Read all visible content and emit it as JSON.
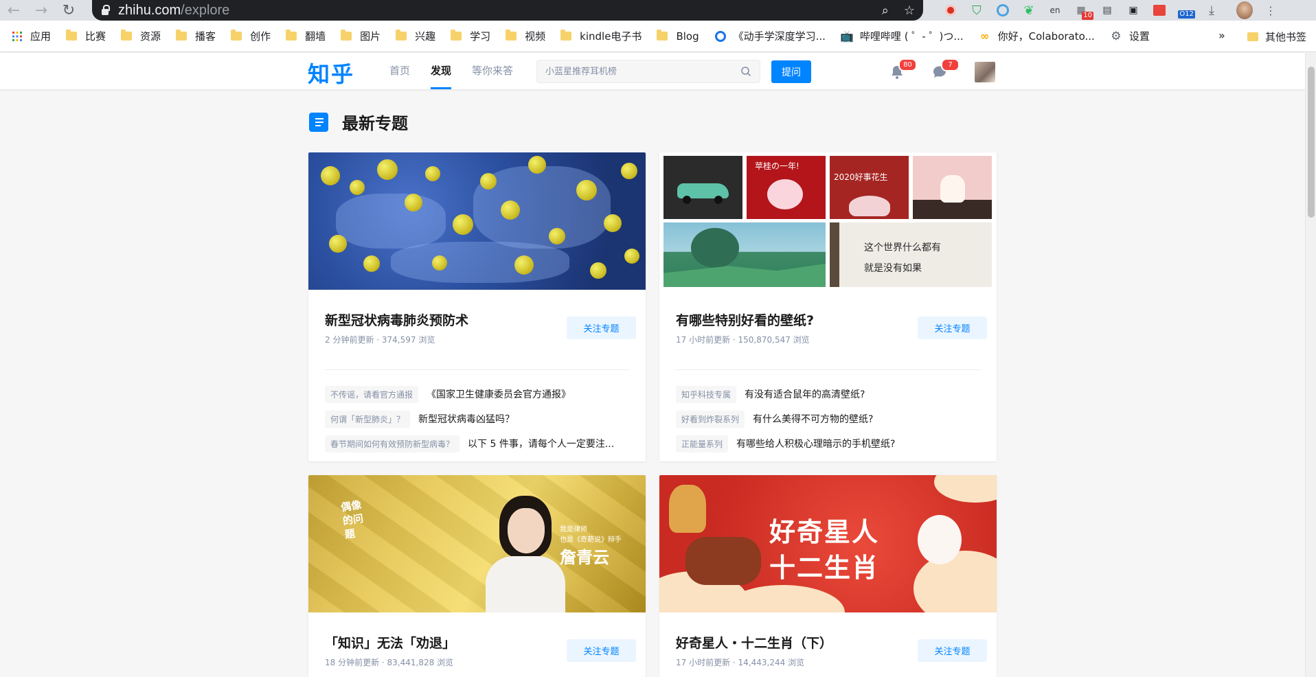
{
  "browser": {
    "host": "zhihu.com",
    "path": "/explore",
    "extensions": [
      {
        "icon": "red-dot-icon",
        "badge": ""
      },
      {
        "icon": "shield-check-icon",
        "badge": ""
      },
      {
        "icon": "circle-target-icon",
        "badge": ""
      },
      {
        "icon": "evernote-icon",
        "badge": ""
      },
      {
        "icon": "translate-icon",
        "badge": ""
      },
      {
        "icon": "grid-apps-icon",
        "badge": "10"
      },
      {
        "icon": "reader-icon",
        "badge": ""
      },
      {
        "icon": "picture-in-picture-icon",
        "badge": ""
      },
      {
        "icon": "notes-icon",
        "badge": ""
      },
      {
        "icon": "counter-icon",
        "badge": "O12"
      },
      {
        "icon": "download-icon",
        "badge": ""
      }
    ]
  },
  "bookmarks": {
    "items": [
      {
        "label": "应用",
        "icon": "apps-grid-icon"
      },
      {
        "label": "比赛",
        "icon": "folder-icon"
      },
      {
        "label": "资源",
        "icon": "folder-icon"
      },
      {
        "label": "播客",
        "icon": "folder-icon"
      },
      {
        "label": "创作",
        "icon": "folder-icon"
      },
      {
        "label": "翻墙",
        "icon": "folder-icon"
      },
      {
        "label": "图片",
        "icon": "folder-icon"
      },
      {
        "label": "兴趣",
        "icon": "folder-icon"
      },
      {
        "label": "学习",
        "icon": "folder-icon"
      },
      {
        "label": "视频",
        "icon": "folder-icon"
      },
      {
        "label": "kindle电子书",
        "icon": "folder-icon"
      },
      {
        "label": "Blog",
        "icon": "folder-icon"
      },
      {
        "label": "《动手学深度学习...",
        "icon": "g-logo-icon"
      },
      {
        "label": "哔哩哔哩 ( ゜- ゜)つ...",
        "icon": "bilibili-icon"
      },
      {
        "label": "你好，Colaborato...",
        "icon": "colab-icon"
      },
      {
        "label": "设置",
        "icon": "gear-icon"
      }
    ],
    "more": "»",
    "other": "其他书签"
  },
  "header": {
    "logo": "知乎",
    "tabs": [
      "首页",
      "发现",
      "等你来答"
    ],
    "active_tab": "发现",
    "search_placeholder": "小蓝星推荐耳机榜",
    "ask_label": "提问",
    "notifications": "80",
    "messages": "7"
  },
  "section": {
    "title": "最新专题"
  },
  "cards": [
    {
      "title": "新型冠状病毒肺炎预防术",
      "stats": "2 分钟前更新 · 374,597 浏览",
      "follow": "关注专题",
      "items": [
        {
          "tag": "不传谣，请看官方通报",
          "text": "《国家卫生健康委员会官方通报》"
        },
        {
          "tag": "何谓「新型肺炎」？",
          "text": "新型冠状病毒凶猛吗？"
        },
        {
          "tag": "春节期间如何有效预防新型病毒？",
          "text": "以下 5 件事，请每个人一定要注..."
        }
      ]
    },
    {
      "title": "有哪些特别好看的壁纸?",
      "stats": "17 小时前更新 · 150,870,547 浏览",
      "follow": "关注专题",
      "wallpaper_texts": [
        "苹桂の一年!",
        "2020好事花生",
        "这个世界什么都有",
        "就是没有如果"
      ],
      "items": [
        {
          "tag": "知乎科技专属",
          "text": "有没有适合鼠年的高清壁纸?"
        },
        {
          "tag": "好看到炸裂系列",
          "text": "有什么美得不可方物的壁纸?"
        },
        {
          "tag": "正能量系列",
          "text": "有哪些给人积极心理暗示的手机壁纸?"
        }
      ]
    },
    {
      "title": "「知识」无法「劝退」",
      "stats": "18 分钟前更新 · 83,441,828 浏览",
      "follow": "关注专题",
      "banner": {
        "brand": "偶像的问题",
        "line1": "我是律师",
        "line2": "也是《奇葩说》辩手",
        "name": "詹青云"
      }
    },
    {
      "title": "好奇星人・十二生肖（下）",
      "stats": "17 小时前更新 · 14,443,244 浏览",
      "follow": "关注专题",
      "banner": {
        "line1": "好奇星人",
        "line2": "十二生肖"
      }
    }
  ]
}
